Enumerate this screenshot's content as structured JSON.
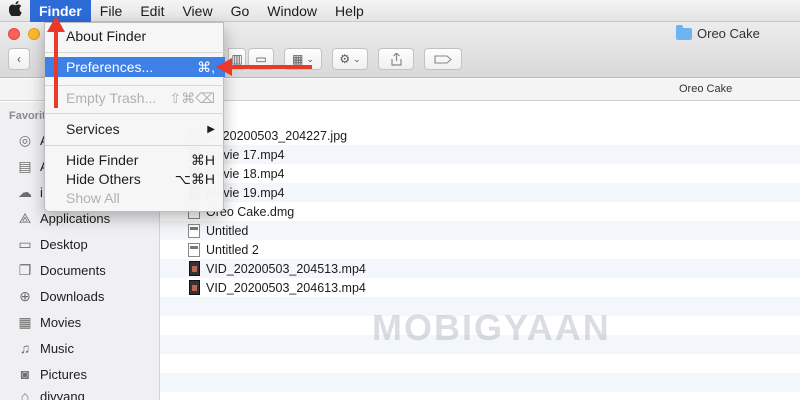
{
  "menubar": {
    "items": [
      "Finder",
      "File",
      "Edit",
      "View",
      "Go",
      "Window",
      "Help"
    ]
  },
  "window": {
    "title": "Oreo Cake",
    "location_header": "Oreo Cake"
  },
  "finder_menu": {
    "about": "About Finder",
    "preferences": {
      "label": "Preferences...",
      "shortcut": "⌘,"
    },
    "empty_trash": {
      "label": "Empty Trash...",
      "shortcut": "⇧⌘⌫"
    },
    "services": {
      "label": "Services",
      "arrow": "▶"
    },
    "hide_finder": {
      "label": "Hide Finder",
      "shortcut": "⌘H"
    },
    "hide_others": {
      "label": "Hide Others",
      "shortcut": "⌥⌘H"
    },
    "show_all": "Show All"
  },
  "sidebar": {
    "heading": "Favorit",
    "items": [
      {
        "label": "A",
        "icon": "airdrop-icon"
      },
      {
        "label": "A",
        "icon": "all-files-icon"
      },
      {
        "label": "i",
        "icon": "icloud-icon"
      },
      {
        "label": "Applications",
        "icon": "applications-icon"
      },
      {
        "label": "Desktop",
        "icon": "desktop-icon"
      },
      {
        "label": "Documents",
        "icon": "documents-icon"
      },
      {
        "label": "Downloads",
        "icon": "downloads-icon"
      },
      {
        "label": "Movies",
        "icon": "movies-icon"
      },
      {
        "label": "Music",
        "icon": "music-icon"
      },
      {
        "label": "Pictures",
        "icon": "pictures-icon"
      },
      {
        "label": "divyang",
        "icon": "home-icon"
      }
    ]
  },
  "files": [
    {
      "name": "G_20200503_204227.jpg",
      "icon": "image-icon"
    },
    {
      "name": "Movie 17.mp4",
      "icon": "video-icon"
    },
    {
      "name": "Movie 18.mp4",
      "icon": "video-icon"
    },
    {
      "name": "Movie 19.mp4",
      "icon": "video-icon"
    },
    {
      "name": "Oreo Cake.dmg",
      "icon": "disk-image-icon"
    },
    {
      "name": "Untitled",
      "icon": "document-icon"
    },
    {
      "name": "Untitled 2",
      "icon": "document-icon"
    },
    {
      "name": "VID_20200503_204513.mp4",
      "icon": "video-icon"
    },
    {
      "name": "VID_20200503_204613.mp4",
      "icon": "video-icon"
    }
  ],
  "watermark": "MOBIGYAAN",
  "colors": {
    "menu_highlight": "#3d80e6",
    "active_menu": "#2d6bd8",
    "annotation_arrow": "#e8392a"
  }
}
